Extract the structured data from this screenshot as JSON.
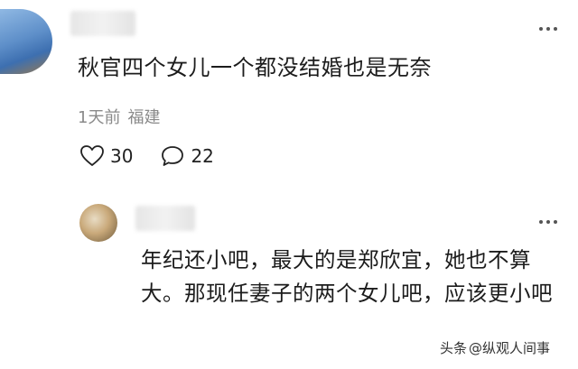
{
  "top_comment": {
    "text": "秋官四个女儿一个都没结婚也是无奈",
    "time": "1天前",
    "location": "福建",
    "likes": "30",
    "replies": "22"
  },
  "reply_comment": {
    "text": "年纪还小吧，最大的是郑欣宜，她也不算大。那现任妻子的两个女儿吧，应该更小吧"
  },
  "watermark": {
    "platform": "头条",
    "account": "@纵观人间事"
  }
}
